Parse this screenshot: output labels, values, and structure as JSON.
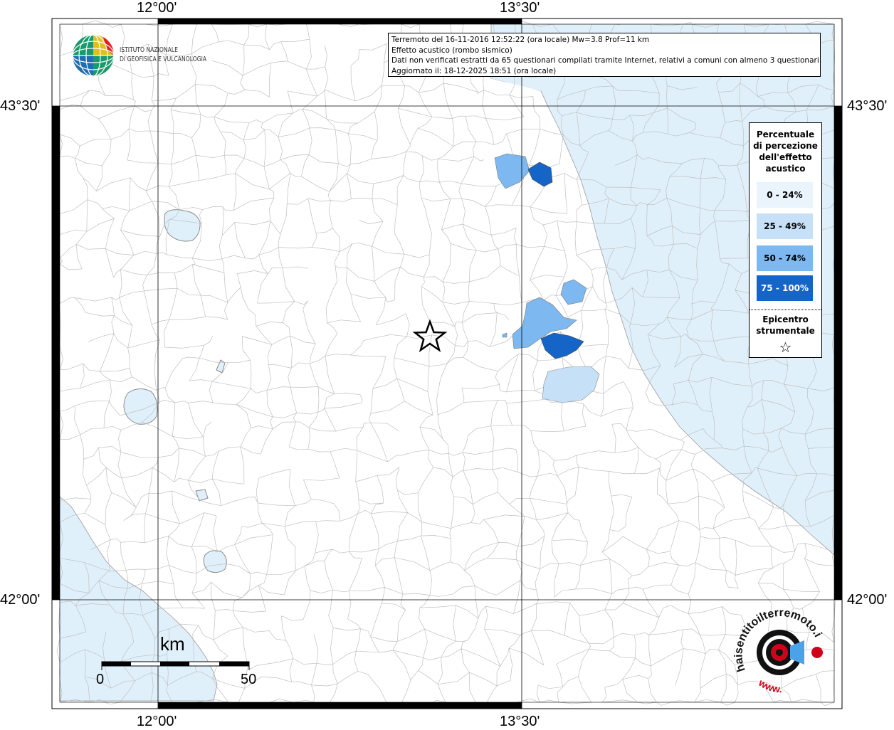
{
  "axes": {
    "top_left": "12°00'",
    "top_right": "13°30'",
    "bottom_left": "12°00'",
    "bottom_right": "13°30'",
    "left_top": "43°30'",
    "left_bottom": "42°00'",
    "right_top": "43°30'",
    "right_bottom": "42°00'"
  },
  "logo": {
    "line1": "ISTITUTO NAZIONALE",
    "line2": "DI GEOFISICA E VULCANOLOGIA"
  },
  "info": {
    "line1": "Terremoto del 16-11-2016 12:52:22 (ora locale) Mw=3.8 Prof=11 km",
    "line2": "Effetto acustico (rombo sismico)",
    "line3": "Dati non verificati estratti da 65 questionari compilati tramite Internet, relativi a comuni con almeno 3 questionari.",
    "line4": "Aggiornato il: 18-12-2025 18:51 (ora locale)"
  },
  "legend": {
    "title_1": "Percentuale",
    "title_2": "di percezione",
    "title_3": "dell'effetto",
    "title_4": "acustico",
    "items": [
      {
        "label": "0 - 24%",
        "color": "#eaf4fd",
        "text_color": "#000000"
      },
      {
        "label": "25 - 49%",
        "color": "#c6e0f8",
        "text_color": "#000000"
      },
      {
        "label": "50 - 74%",
        "color": "#7db8f0",
        "text_color": "#000000"
      },
      {
        "label": "75 - 100%",
        "color": "#1565c8",
        "text_color": "#ffffff"
      }
    ],
    "epicenter_1": "Epicentro",
    "epicenter_2": "strumentale",
    "epicenter_symbol": "☆"
  },
  "scale": {
    "unit": "km",
    "min": "0",
    "max": "50"
  },
  "badge": {
    "text_top": "haisentitoilterremoto.it",
    "text_bottom": "www.",
    "accent": "#d0021b",
    "sound_color": "#4aa3e8"
  },
  "colors": {
    "sea": "#e0f0fb",
    "lake": "#e0f0fb",
    "border": "#b4b4b4",
    "frame": "#000000"
  },
  "epicenter_star": "☆"
}
